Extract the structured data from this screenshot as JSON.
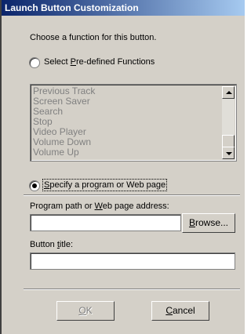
{
  "window": {
    "title": "Launch Button Customization"
  },
  "instruction": "Choose a function for this button.",
  "radio_predefined": {
    "label_prefix": "Select ",
    "label_mnemonic": "P",
    "label_rest": "re-defined Functions",
    "selected": false
  },
  "functions_list": {
    "items": [
      "Previous Track",
      "Screen Saver",
      "Search",
      "Stop",
      "Video Player",
      "Volume Down",
      "Volume Up"
    ],
    "enabled": false
  },
  "radio_program": {
    "label_mnemonic": "S",
    "label_rest": "pecify a program or Web page",
    "selected": true
  },
  "program_path": {
    "label_a": "Program path or ",
    "label_mnemonic": "W",
    "label_b": "eb page address:",
    "value": ""
  },
  "browse_button": {
    "label_mnemonic": "B",
    "label_rest": "rowse..."
  },
  "button_title": {
    "label_a": "Button ",
    "label_mnemonic": "t",
    "label_b": "itle:",
    "value": ""
  },
  "ok_button": {
    "label_mnemonic": "O",
    "label_rest": "K",
    "enabled": false
  },
  "cancel_button": {
    "label_mnemonic": "C",
    "label_rest": "ancel"
  }
}
